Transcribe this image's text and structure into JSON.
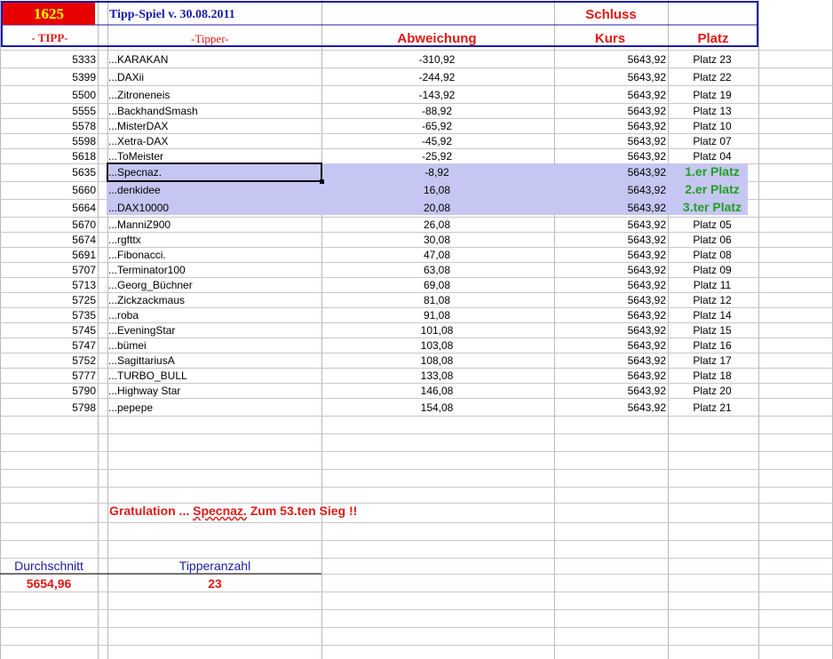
{
  "header": {
    "number": "1625",
    "title": "Tipp-Spiel v. 30.08.2011",
    "schluss": "Schluss",
    "col_tipp": "- TIPP-",
    "col_tipper": "-Tipper-",
    "col_abweichung": "Abweichung",
    "col_kurs": "Kurs",
    "col_platz": "Platz"
  },
  "colors": {
    "header_number_bg": "#e80000",
    "header_number_fg": "#ffff00",
    "highlight_row": "#c6c6f2",
    "winner_text": "#22a022",
    "accent_red": "#e21818",
    "title_blue": "#1a1aa8"
  },
  "rows": [
    {
      "tipp": "5333",
      "name": "...KARAKAN",
      "abw": "-310,92",
      "kurs": "5643,92",
      "platz": "Platz 23"
    },
    {
      "tipp": "5399",
      "name": "...DAXii",
      "abw": "-244,92",
      "kurs": "5643,92",
      "platz": "Platz 22"
    },
    {
      "tipp": "5500",
      "name": "...Zitroneneis",
      "abw": "-143,92",
      "kurs": "5643,92",
      "platz": "Platz 19"
    },
    {
      "tipp": "5555",
      "name": "...BackhandSmash",
      "abw": "-88,92",
      "kurs": "5643,92",
      "platz": "Platz 13"
    },
    {
      "tipp": "5578",
      "name": "...MisterDAX",
      "abw": "-65,92",
      "kurs": "5643,92",
      "platz": "Platz 10"
    },
    {
      "tipp": "5598",
      "name": "...Xetra-DAX",
      "abw": "-45,92",
      "kurs": "5643,92",
      "platz": "Platz 07"
    },
    {
      "tipp": "5618",
      "name": "...ToMeister",
      "abw": "-25,92",
      "kurs": "5643,92",
      "platz": "Platz 04"
    },
    {
      "tipp": "5635",
      "name": "...Specnaz.",
      "abw": "-8,92",
      "kurs": "5643,92",
      "platz": "1.er Platz"
    },
    {
      "tipp": "5660",
      "name": "...denkidee",
      "abw": "16,08",
      "kurs": "5643,92",
      "platz": "2.er Platz"
    },
    {
      "tipp": "5664",
      "name": "...DAX10000",
      "abw": "20,08",
      "kurs": "5643,92",
      "platz": "3.ter Platz"
    },
    {
      "tipp": "5670",
      "name": "...ManniZ900",
      "abw": "26,08",
      "kurs": "5643,92",
      "platz": "Platz 05"
    },
    {
      "tipp": "5674",
      "name": "...rgfttx",
      "abw": "30,08",
      "kurs": "5643,92",
      "platz": "Platz 06"
    },
    {
      "tipp": "5691",
      "name": "...Fibonacci.",
      "abw": "47,08",
      "kurs": "5643,92",
      "platz": "Platz 08"
    },
    {
      "tipp": "5707",
      "name": "...Terminator100",
      "abw": "63,08",
      "kurs": "5643,92",
      "platz": "Platz 09"
    },
    {
      "tipp": "5713",
      "name": "...Georg_Büchner",
      "abw": "69,08",
      "kurs": "5643,92",
      "platz": "Platz 11"
    },
    {
      "tipp": "5725",
      "name": "...Zickzackmaus",
      "abw": "81,08",
      "kurs": "5643,92",
      "platz": "Platz 12"
    },
    {
      "tipp": "5735",
      "name": "...roba",
      "abw": "91,08",
      "kurs": "5643,92",
      "platz": "Platz 14"
    },
    {
      "tipp": "5745",
      "name": "...EveningStar",
      "abw": "101,08",
      "kurs": "5643,92",
      "platz": "Platz 15"
    },
    {
      "tipp": "5747",
      "name": "...bümei",
      "abw": "103,08",
      "kurs": "5643,92",
      "platz": "Platz 16"
    },
    {
      "tipp": "5752",
      "name": "...SagittariusA",
      "abw": "108,08",
      "kurs": "5643,92",
      "platz": "Platz 17"
    },
    {
      "tipp": "5777",
      "name": "...TURBO_BULL",
      "abw": "133,08",
      "kurs": "5643,92",
      "platz": "Platz 18"
    },
    {
      "tipp": "5790",
      "name": "...Highway Star",
      "abw": "146,08",
      "kurs": "5643,92",
      "platz": "Platz 20"
    },
    {
      "tipp": "5798",
      "name": "...pepepe",
      "abw": "154,08",
      "kurs": "5643,92",
      "platz": "Platz 21"
    }
  ],
  "congrats": {
    "prefix": "Gratulation ... ",
    "name": "Specnaz.",
    "suffix": "  Zum  53.ten Sieg !!"
  },
  "summary": {
    "avg_label": "Durchschnitt",
    "avg_value": "5654,96",
    "count_label": "Tipperanzahl",
    "count_value": "23"
  }
}
